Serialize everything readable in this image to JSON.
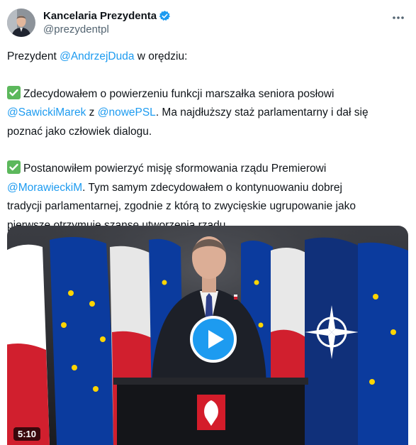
{
  "author": {
    "name": "Kancelaria Prezydenta",
    "handle": "@prezydentpl",
    "verified": true
  },
  "icons": {
    "verified": "verified-badge-icon",
    "more": "more-options-icon",
    "check": "check-mark-icon",
    "play": "play-icon"
  },
  "tweet": {
    "p1_prefix": "Prezydent ",
    "p1_mention": "@AndrzejDuda",
    "p1_suffix": " w orędziu:",
    "p2_text": "Zdecydowałem o powierzeniu funkcji marszałka seniora posłowi",
    "p2_mention1": "@SawickiMarek",
    "p2_mid": " z ",
    "p2_mention2": "@nowePSL",
    "p2_suffix": ". Ma najdłuższy staż parlamentarny i dał się",
    "p2_line3": "poznać jako człowiek dialogu.",
    "p3_text": "Postanowiłem  powierzyć misję sformowania rządu Premierowi",
    "p3_mention": "@MorawieckiM",
    "p3_suffix": ". Tym samym zdecydowałem o kontynuowaniu dobrej",
    "p3_line3": "tradycji parlamentarnej, zgodnie z którą to zwycięskie ugrupowanie jako",
    "p3_line4": "pierwsze otrzymuje szansę utworzenia rządu."
  },
  "video": {
    "duration": "5:10"
  },
  "colors": {
    "accent": "#1d9bf0",
    "check": "#5cb85c",
    "text": "#0f1419",
    "muted": "#536471"
  }
}
